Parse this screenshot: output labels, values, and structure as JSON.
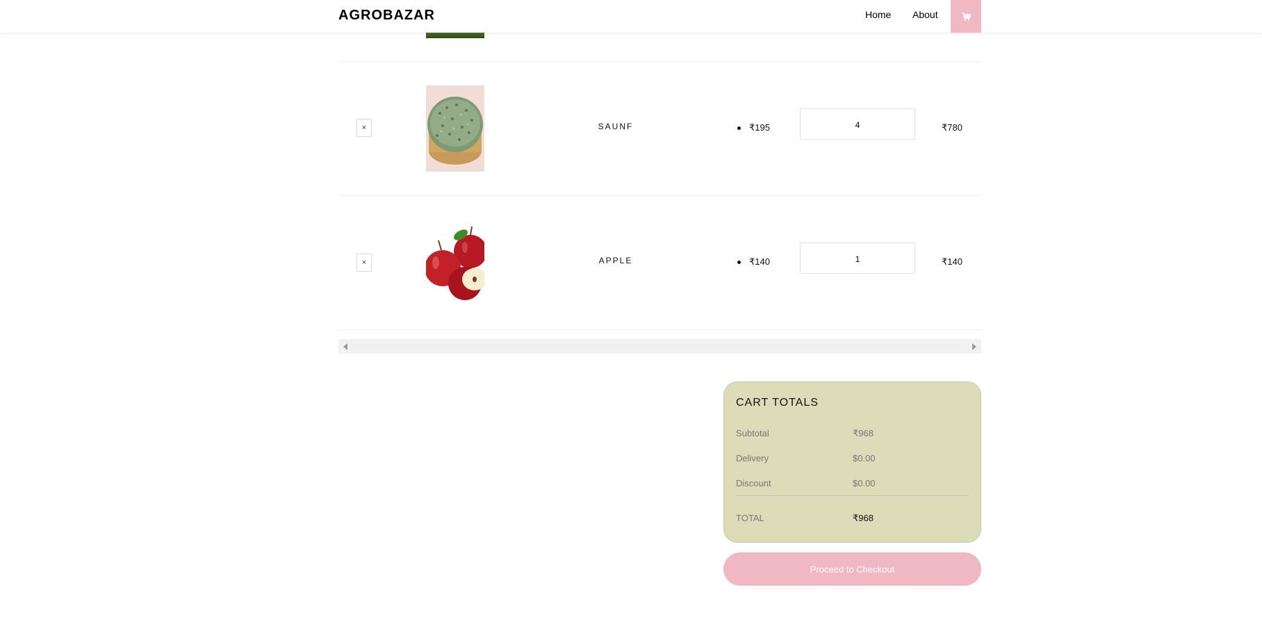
{
  "header": {
    "brand": "AGROBAZAR",
    "nav": [
      {
        "label": "Home"
      },
      {
        "label": "About"
      }
    ],
    "cart_icon": "cart-icon"
  },
  "cart": {
    "items": [
      {
        "remove_label": "×",
        "name": "SAUNF",
        "price": "₹195",
        "quantity": "4",
        "total": "₹780"
      },
      {
        "remove_label": "×",
        "name": "APPLE",
        "price": "₹140",
        "quantity": "1",
        "total": "₹140"
      }
    ]
  },
  "totals": {
    "title": "CART TOTALS",
    "subtotal_label": "Subtotal",
    "subtotal_value": "₹968",
    "delivery_label": "Delivery",
    "delivery_value": "$0.00",
    "discount_label": "Discount",
    "discount_value": "$0.00",
    "total_label": "TOTAL",
    "total_value": "₹968"
  },
  "checkout": {
    "label": "Proceed to Checkout"
  },
  "colors": {
    "accent_pink": "#f0b8c3",
    "totals_bg": "#dddcb9"
  }
}
